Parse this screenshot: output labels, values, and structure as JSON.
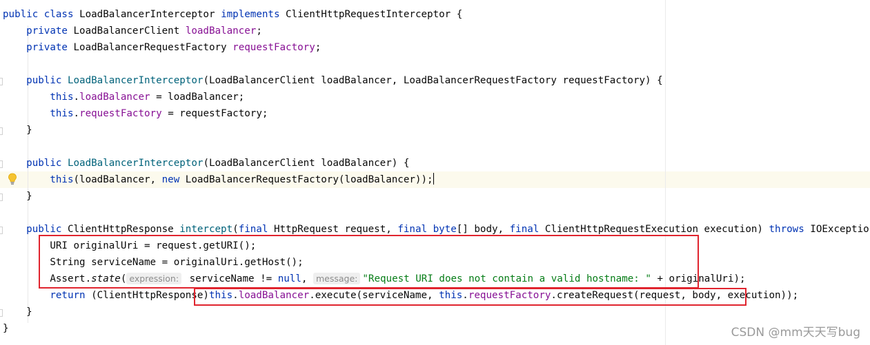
{
  "code": {
    "l1": {
      "kw1": "public",
      "kw2": "class",
      "name": "LoadBalancerInterceptor",
      "kw3": "implements",
      "iface": "ClientHttpRequestInterceptor {"
    },
    "l2": {
      "kw": "private",
      "type": "LoadBalancerClient",
      "field": "loadBalancer",
      "end": ";"
    },
    "l3": {
      "kw": "private",
      "type": "LoadBalancerRequestFactory",
      "field": "requestFactory",
      "end": ";"
    },
    "l5": {
      "kw": "public",
      "name": "LoadBalancerInterceptor",
      "params": "(LoadBalancerClient loadBalancer, LoadBalancerRequestFactory requestFactory) {"
    },
    "l6": {
      "kw": "this",
      "field": "loadBalancer",
      "rest": " = loadBalancer;"
    },
    "l7": {
      "kw": "this",
      "field": "requestFactory",
      "rest": " = requestFactory;"
    },
    "l8": "}",
    "l10": {
      "kw": "public",
      "name": "LoadBalancerInterceptor",
      "params": "(LoadBalancerClient loadBalancer) {"
    },
    "l11": {
      "kw1": "this",
      "mid": "(loadBalancer, ",
      "kw2": "new",
      "rest": " LoadBalancerRequestFactory(loadBalancer));"
    },
    "l12": "}",
    "l14": {
      "kw1": "public",
      "type": "ClientHttpResponse",
      "name": "intercept",
      "p1": "(",
      "kw2": "final",
      "p2": " HttpRequest request, ",
      "kw3": "final",
      "kw4": "byte",
      "p3": "[] body, ",
      "kw5": "final",
      "p4": " ClientHttpRequestExecution execution) ",
      "kw6": "throws",
      "p5": " IOException {"
    },
    "l15": "URI originalUri = request.getURI();",
    "l16": "String serviceName = originalUri.getHost();",
    "l17": {
      "pre": "Assert.",
      "method": "state",
      "paren": "(",
      "hint1": "expression:",
      "arg1": " serviceName != ",
      "kw": "null",
      "comma": ", ",
      "hint2": "message:",
      "str": "\"Request URI does not contain a valid hostname: \"",
      "rest": " + originalUri);"
    },
    "l18": {
      "kw1": "return",
      "cast": " (ClientHttpResponse)",
      "kw2": "this",
      "dot1": ".",
      "field1": "loadBalancer",
      "mid": ".execute(serviceName, ",
      "kw3": "this",
      "dot2": ".",
      "field2": "requestFactory",
      "rest": ".createRequest(request, body, execution));"
    },
    "l19": "}",
    "l20": "}"
  },
  "watermark": "CSDN @mm天天写bug",
  "colors": {
    "keyword": "#0033b3",
    "field": "#871094",
    "method": "#00627a",
    "string": "#067d17",
    "highlight_box": "#e0242e"
  },
  "icons": {
    "bulb": "lightbulb-icon"
  }
}
